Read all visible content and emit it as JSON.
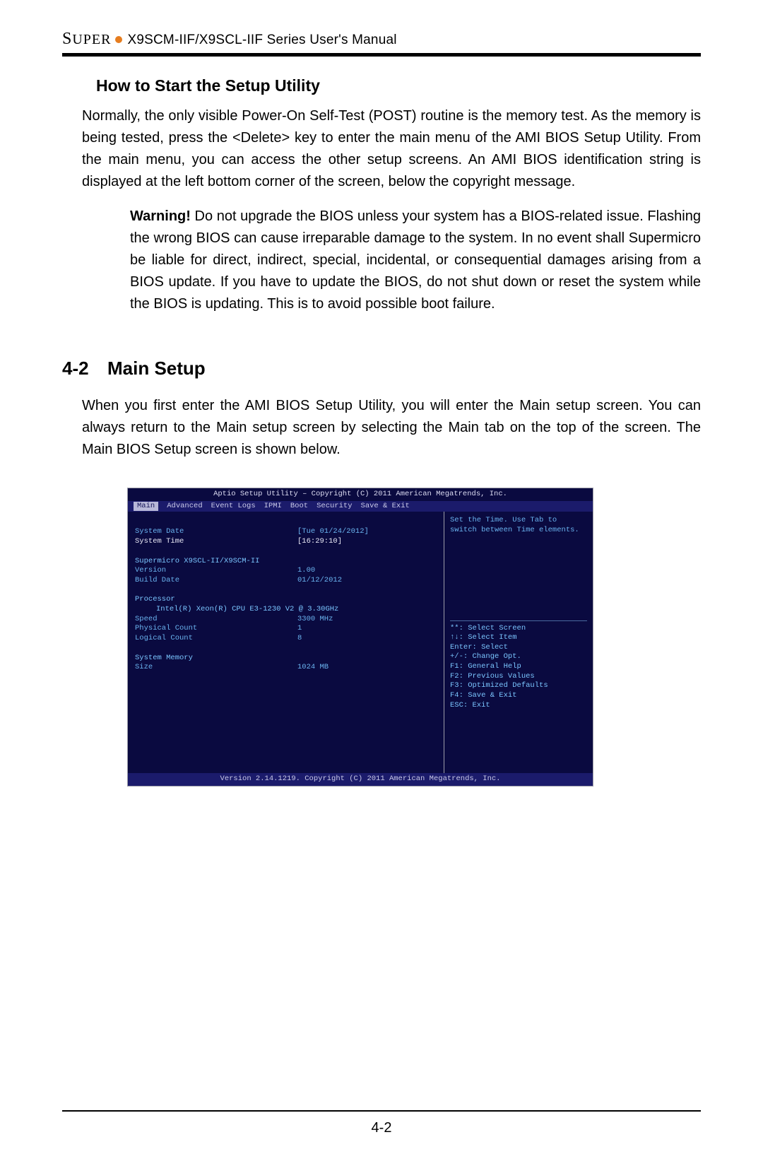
{
  "header": {
    "brand_prefix": "S",
    "brand_rest": "UPER",
    "manual_title": "X9SCM-IIF/X9SCL-IIF Series User's Manual"
  },
  "section_small_title": "How to Start the Setup Utility",
  "para1": "Normally, the only visible Power-On Self-Test (POST) routine is the memory test. As the memory is being tested, press the <Delete> key to enter the main menu of the AMI BIOS Setup Utility. From the main menu, you can access the other setup screens. An AMI BIOS identification string is displayed at the left bottom corner of the screen, below the copyright message.",
  "warning_label": "Warning!",
  "warning_text": " Do not upgrade the BIOS unless your system has a BIOS-related issue. Flashing the wrong BIOS can cause irreparable damage to the system. In no event shall Supermicro be liable for direct, indirect, special, incidental, or consequential damages arising from a BIOS update. If you have to update the BIOS, do not shut down or reset the system while the BIOS is updating. This is to avoid possible boot failure.",
  "section_num": "4-2",
  "section_title": "Main Setup",
  "para2": "When you first enter the AMI BIOS Setup Utility, you will enter the Main setup screen. You can always return to the Main setup screen by selecting the Main tab on the top of the screen. The Main BIOS Setup screen is shown below.",
  "bios": {
    "titlebar": "Aptio Setup Utility – Copyright (C) 2011 American Megatrends, Inc.",
    "tabs": [
      "Main",
      "Advanced",
      "Event Logs",
      "IPMI",
      "Boot",
      "Security",
      "Save & Exit"
    ],
    "left": {
      "system_date_label": "System Date",
      "system_date_value": "[Tue 01/24/2012]",
      "system_time_label": "System Time",
      "system_time_value": "[16:29:10]",
      "board_line": "Supermicro X9SCL-II/X9SCM-II",
      "version_label": "Version",
      "version_value": "1.00",
      "build_date_label": "Build Date",
      "build_date_value": "01/12/2012",
      "processor_label": "Processor",
      "processor_model": "Intel(R) Xeon(R) CPU E3-1230 V2 @ 3.30GHz",
      "speed_label": "Speed",
      "speed_value": "3300 MHz",
      "phys_label": "Physical Count",
      "phys_value": "1",
      "logical_label": "Logical Count",
      "logical_value": "8",
      "mem_label": "System Memory",
      "size_label": "Size",
      "size_value": "1024 MB"
    },
    "right": {
      "help_top1": "Set the Time. Use Tab to",
      "help_top2": "switch between Time elements.",
      "nav": [
        "**: Select Screen",
        "↑↓: Select Item",
        "Enter: Select",
        "+/-: Change Opt.",
        "F1: General Help",
        "F2: Previous Values",
        "F3: Optimized Defaults",
        "F4: Save & Exit",
        "ESC: Exit"
      ]
    },
    "footer": "Version 2.14.1219. Copyright (C) 2011 American Megatrends, Inc."
  },
  "page_num": "4-2"
}
